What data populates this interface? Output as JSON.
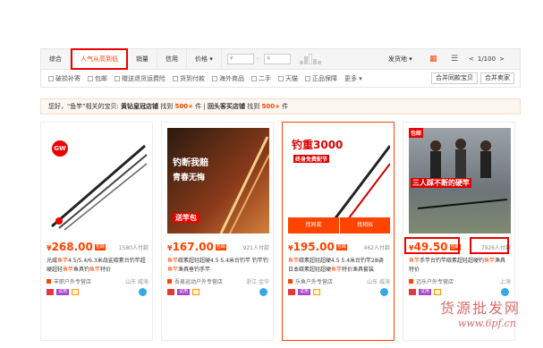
{
  "sort": {
    "tabs": [
      "综合",
      "人气从高到低",
      "销量",
      "信用"
    ],
    "price_label": "价格",
    "price_min_placeholder": "¥",
    "price_max_placeholder": "¥",
    "ship_from": "发货地",
    "page": "1/100",
    "prev": "<",
    "next": ">"
  },
  "filters": {
    "items": [
      "破损补寄",
      "包邮",
      "赠送退货运费险",
      "货到付款",
      "海外商品",
      "二手",
      "天猫",
      "正品保障"
    ],
    "more": "更多",
    "merge_same": "合并同款宝贝",
    "merge_seller": "合并卖家"
  },
  "tip": {
    "prefix": "您好，",
    "keyword": "\"鱼竿\"",
    "mid1": "相关的宝贝: ",
    "label1": "黄钻皇冠店铺",
    "found1": " 找到 ",
    "count1": "500+",
    "unit1": " 件",
    "sep": " | ",
    "label2": "回头客买店铺",
    "found2": " 找到 ",
    "count2": "500+",
    "unit2": " 件"
  },
  "products": [
    {
      "price": "268.00",
      "paid": "1580人付款",
      "title_pre": "光威",
      "title_red1": "鱼竿",
      "title_mid": "4.5/5.4/6.3米战鲨碳素台钓竿超硬超轻",
      "title_red2": "鱼竿",
      "title_post": "鱼具钓",
      "title_red3": "鱼竿",
      "title_end": "特价",
      "shop": "丰职户外专营店",
      "location": "山东 威海",
      "img_text": "GW",
      "badge_try": "试用"
    },
    {
      "price": "167.00",
      "paid": "921人付款",
      "title_pre": "",
      "title_red1": "鱼竿",
      "title_mid": "碳素超轻超硬4.5 5.4米台钓竿 钓竿钓",
      "title_red2": "鱼竿",
      "title_post": "渔具垂钓手竿",
      "title_red3": "",
      "title_end": "",
      "shop": "吾易运动户外专营店",
      "location": "浙江 金华",
      "img_text": "钓断我赔",
      "img_text2": "青春无悔",
      "img_text3": "送竿包",
      "badge_try": "试用"
    },
    {
      "price": "195.00",
      "paid": "462人付款",
      "title_pre": "",
      "title_red1": "鱼竿",
      "title_mid": "碳素超轻超硬4.5 5.4米台钓竿28调 日本碳素超轻超硬",
      "title_red2": "鱼竿",
      "title_post": "特价渔具套装",
      "title_red3": "",
      "title_end": "",
      "shop": "乐鱼户外专营店",
      "location": "山东 威海",
      "img_text": "钓重3000",
      "img_text2": "终身免费配节",
      "img_text3": "找同款",
      "img_text4": "找相似",
      "badge_try": "试用"
    },
    {
      "price": "49.50",
      "paid": "7926人付款",
      "title_pre": "",
      "title_red1": "鱼竿",
      "title_mid": "手竿台钓竿碳素超轻超硬钓",
      "title_red2": "鱼竿",
      "title_post": "渔具特价",
      "title_red3": "",
      "title_end": "",
      "shop": "迈乐户外专营店",
      "location": "上海",
      "img_text": "三人踩不断的硬竿",
      "img_text2": "包邮",
      "badge_try": "试用"
    }
  ],
  "watermark": {
    "line1": "货源批发网",
    "line2": "www.6pf.cn"
  },
  "colors": {
    "accent": "#ff4400",
    "highlight_box": "#ee0000"
  }
}
